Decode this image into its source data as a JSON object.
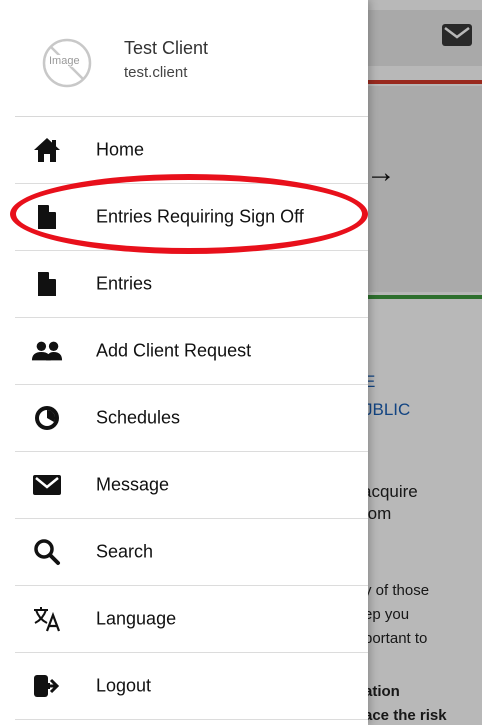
{
  "profile": {
    "avatar_alt": "Image",
    "name": "Test Client",
    "username": "test.client"
  },
  "menu": {
    "items": [
      {
        "label": "Home",
        "icon": "home-icon"
      },
      {
        "label": "Entries Requiring Sign Off",
        "icon": "document-icon"
      },
      {
        "label": "Entries",
        "icon": "document-icon"
      },
      {
        "label": "Add Client Request",
        "icon": "users-icon"
      },
      {
        "label": "Schedules",
        "icon": "clock-icon"
      },
      {
        "label": "Message",
        "icon": "envelope-icon"
      },
      {
        "label": "Search",
        "icon": "search-icon"
      },
      {
        "label": "Language",
        "icon": "translate-icon"
      },
      {
        "label": "Logout",
        "icon": "logout-icon"
      }
    ]
  },
  "background": {
    "arrow": "→",
    "link_lines": [
      "E",
      "JBLIC"
    ],
    "text_lines_1": [
      "acquire",
      "rom"
    ],
    "text_lines_2": [
      "y of those",
      "ep you",
      "portant to"
    ],
    "bold_lines": [
      "ation",
      "ace the risk"
    ]
  },
  "colors": {
    "highlight": "#e8101b",
    "link": "#1a5fb4",
    "top_accent": "#d43a2a",
    "bottom_accent": "#3f9a3f"
  }
}
